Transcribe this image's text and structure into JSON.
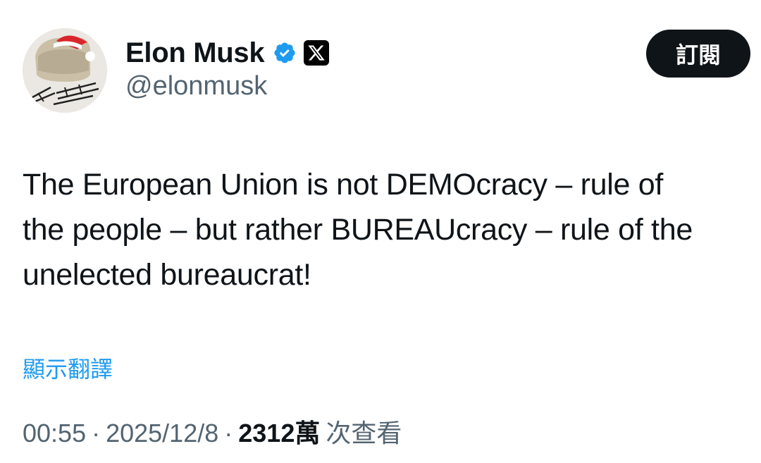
{
  "author": {
    "display_name": "Elon Musk",
    "handle": "@elonmusk",
    "verified_icon": "verified-badge-icon",
    "affiliation_icon": "x-logo-icon",
    "avatar": "avatar-image"
  },
  "subscribe_button": {
    "label": "訂閱"
  },
  "tweet": {
    "lines": [
      "The European Union is not DEMOcracy – rule of",
      "the people – but rather BUREAUcracy – rule of the",
      "unelected bureaucrat!"
    ]
  },
  "translate_link": "顯示翻譯",
  "meta": {
    "time": "00:55",
    "separator": "·",
    "date": "2025/12/8",
    "views_count": "2312萬",
    "views_label": "次查看"
  },
  "colors": {
    "text_primary": "#0f1419",
    "text_secondary": "#536471",
    "link_blue": "#1d9bf0",
    "verified_blue": "#1d9bf0",
    "button_bg": "#0f1419"
  }
}
